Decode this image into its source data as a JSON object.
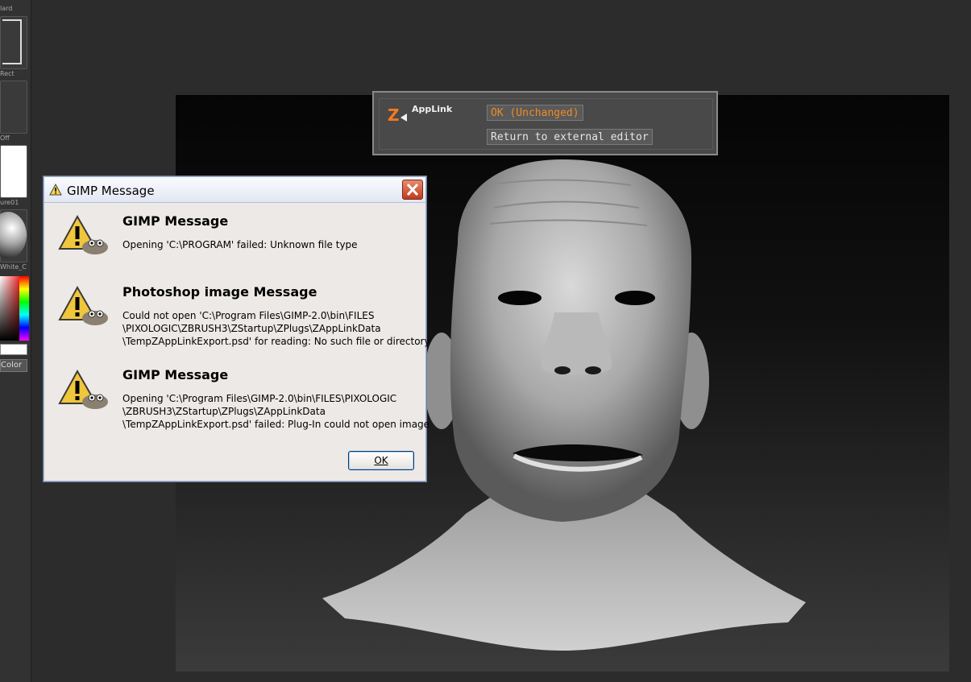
{
  "shelf": {
    "labels": [
      "Rect",
      "Off",
      "ure01",
      "White_C",
      "Color"
    ],
    "top_label": "lard"
  },
  "applink": {
    "logo_text": "AppLink",
    "ok_button": "OK (Unchanged)",
    "return_button": "Return to external editor",
    "ok_color": "#f08a24",
    "text_color": "#e6e6e6"
  },
  "dialog": {
    "title": "GIMP Message",
    "messages": [
      {
        "heading": "GIMP Message",
        "body": "Opening 'C:\\PROGRAM' failed: Unknown file type"
      },
      {
        "heading": "Photoshop image Message",
        "body": "Could not open 'C:\\Program Files\\GIMP-2.0\\bin\\FILES\n\\PIXOLOGIC\\ZBRUSH3\\ZStartup\\ZPlugs\\ZAppLinkData\n\\TempZAppLinkExport.psd' for reading: No such file or directory"
      },
      {
        "heading": "GIMP Message",
        "body": "Opening 'C:\\Program Files\\GIMP-2.0\\bin\\FILES\\PIXOLOGIC\n\\ZBRUSH3\\ZStartup\\ZPlugs\\ZAppLinkData\n\\TempZAppLinkExport.psd' failed: Plug-In could not open image"
      }
    ],
    "ok_button": "OK"
  }
}
